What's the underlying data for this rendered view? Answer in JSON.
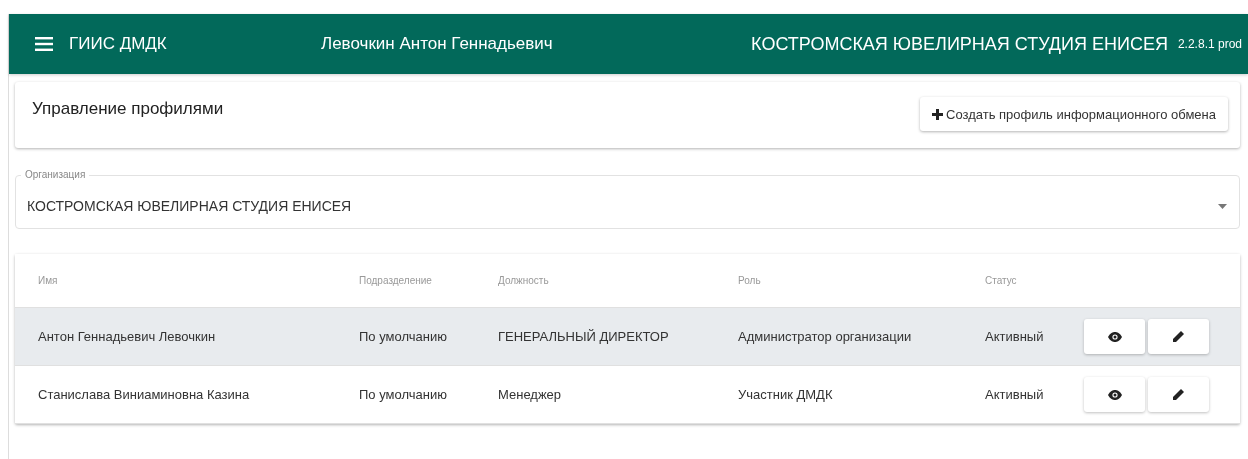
{
  "header": {
    "app_title": "ГИИС ДМДК",
    "user": "Левочкин Антон Геннадьевич",
    "organization": "КОСТРОМСКАЯ ЮВЕЛИРНАЯ СТУДИЯ ЕНИСЕЯ",
    "version": "2.2.8.1 prod"
  },
  "page": {
    "title": "Управление профилями",
    "create_button": "Создать профиль информационного обмена"
  },
  "organization_field": {
    "label": "Организация",
    "value": "КОСТРОМСКАЯ ЮВЕЛИРНАЯ СТУДИЯ ЕНИСЕЯ"
  },
  "table": {
    "columns": [
      "Имя",
      "Подразделение",
      "Должность",
      "Роль",
      "Статус"
    ],
    "rows": [
      {
        "name": "Антон Геннадьевич Левочкин",
        "division": "По умолчанию",
        "position": "ГЕНЕРАЛЬНЫЙ ДИРЕКТОР",
        "role": "Администратор организации",
        "status": "Активный",
        "selected": true
      },
      {
        "name": "Станислава Виниаминовна Казина",
        "division": "По умолчанию",
        "position": "Менеджер",
        "role": "Участник ДМДК",
        "status": "Активный",
        "selected": false
      }
    ]
  }
}
